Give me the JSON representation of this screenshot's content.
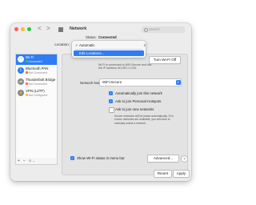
{
  "window": {
    "title": "Network",
    "search_placeholder": "Search",
    "nav_back": "<",
    "nav_forward": ">"
  },
  "location": {
    "label": "Location:",
    "menu": {
      "selected": "Automatic",
      "items": [
        "Automatic",
        "Edit Locations..."
      ],
      "highlighted": "Edit Locations..."
    }
  },
  "sidebar": {
    "items": [
      {
        "name": "Wi-Fi",
        "status": "Connected",
        "status_color": "#33c748",
        "icon": "wifi-icon",
        "glyph": "◠"
      },
      {
        "name": "Bluetooth PAN",
        "status": "Not Connected",
        "status_color": "#ff5f57",
        "icon": "bluetooth-icon",
        "glyph": "ᛒ"
      },
      {
        "name": "Thunderbolt Bridge",
        "status": "Not Connected",
        "status_color": "#ff5f57",
        "icon": "thunderbolt-bridge-icon",
        "glyph": "⇄"
      },
      {
        "name": "VPN (L2TP)",
        "status": "Not Configured",
        "status_color": "#febc2e",
        "icon": "vpn-icon",
        "glyph": "🔒"
      }
    ],
    "tools": {
      "add": "+",
      "remove": "−",
      "actions": "⊙ ⌄"
    }
  },
  "detail": {
    "status_label": "Status:",
    "status_value": "Connected",
    "turn_off_label": "Turn Wi-Fi Off",
    "status_description": "Wi-Fi is connected to WiFi-Secure and has the IP address 161.051.1.1/16.",
    "network_name_label": "Network Name:",
    "network_name_value": "WiFi-Secure",
    "checkboxes": [
      {
        "label": "Automatically join this network",
        "checked": true
      },
      {
        "label": "Ask to join Personal Hotspots",
        "checked": true
      },
      {
        "label": "Ask to join new networks",
        "checked": false
      }
    ],
    "hint": "Known networks will be joined automatically. If no known networks are available, you will have to manually select a network.",
    "show_menu_bar_label": "Show Wi-Fi status in menu bar",
    "advanced_label": "Advanced...",
    "help_label": "?",
    "revert_label": "Revert",
    "apply_label": "Apply"
  },
  "colors": {
    "accent": "#2f7cf6",
    "connected": "#33c748",
    "not_connected": "#ff5f57",
    "not_configured": "#febc2e"
  }
}
